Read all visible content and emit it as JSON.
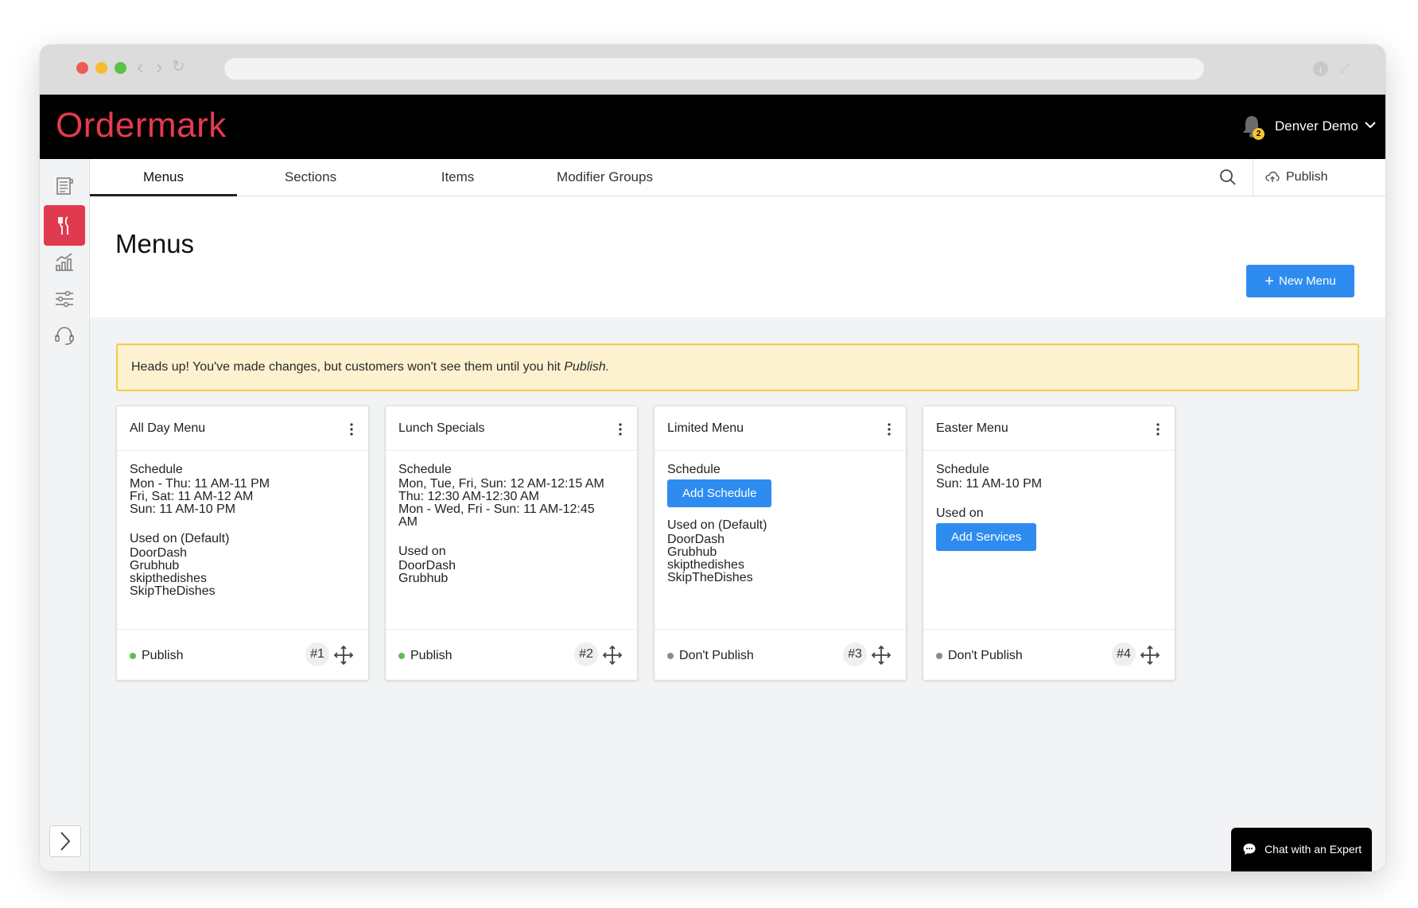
{
  "app": {
    "logo_text": "Ordermark",
    "brand_color": "#e43b4f",
    "account_name": "Denver Demo",
    "notification_count": "2"
  },
  "sidebar": {
    "items": [
      {
        "icon": "orders-icon"
      },
      {
        "icon": "menu-utensils-icon",
        "active": true
      },
      {
        "icon": "analytics-icon"
      },
      {
        "icon": "settings-sliders-icon"
      },
      {
        "icon": "support-headset-icon"
      }
    ],
    "expand_icon": "chevron-right-icon"
  },
  "tabs": {
    "items": [
      {
        "label": "Menus",
        "active": true
      },
      {
        "label": "Sections"
      },
      {
        "label": "Items"
      },
      {
        "label": "Modifier Groups"
      }
    ],
    "publish_label": "Publish"
  },
  "page": {
    "title": "Menus",
    "new_button_label": "New Menu",
    "accent_color": "#2e8cf0"
  },
  "alert": {
    "text": "Heads up! You've made changes, but customers won't see them until you hit ",
    "emphasis": "Publish."
  },
  "cards": [
    {
      "title": "All Day Menu",
      "schedule_label": "Schedule",
      "schedule": [
        "Mon - Thu: 11 AM-11 PM",
        "Fri, Sat: 11 AM-12 AM",
        "Sun: 11 AM-10 PM"
      ],
      "used_label": "Used on (Default)",
      "services": [
        "DoorDash",
        "Grubhub",
        "skipthedishes",
        "SkipTheDishes"
      ],
      "status": "Publish",
      "status_color": "#5cc24a",
      "position": "#1"
    },
    {
      "title": "Lunch Specials",
      "schedule_label": "Schedule",
      "schedule": [
        "Mon, Tue, Fri, Sun: 12 AM-12:15 AM",
        "Thu: 12:30 AM-12:30 AM",
        "Mon - Wed, Fri - Sun: 11 AM-12:45",
        "AM"
      ],
      "used_label": "Used on",
      "services": [
        "DoorDash",
        "Grubhub"
      ],
      "status": "Publish",
      "status_color": "#5cc24a",
      "position": "#2"
    },
    {
      "title": "Limited Menu",
      "schedule_label": "Schedule",
      "schedule_action": "Add Schedule",
      "used_label": "Used on (Default)",
      "services": [
        "DoorDash",
        "Grubhub",
        "skipthedishes",
        "SkipTheDishes"
      ],
      "status": "Don't Publish",
      "status_color": "#8a8a8a",
      "position": "#3"
    },
    {
      "title": "Easter Menu",
      "schedule_label": "Schedule",
      "schedule": [
        "Sun: 11 AM-10 PM"
      ],
      "used_label": "Used on",
      "services_action": "Add Services",
      "status": "Don't Publish",
      "status_color": "#8a8a8a",
      "position": "#4"
    }
  ],
  "chat": {
    "label": "Chat with an Expert"
  }
}
